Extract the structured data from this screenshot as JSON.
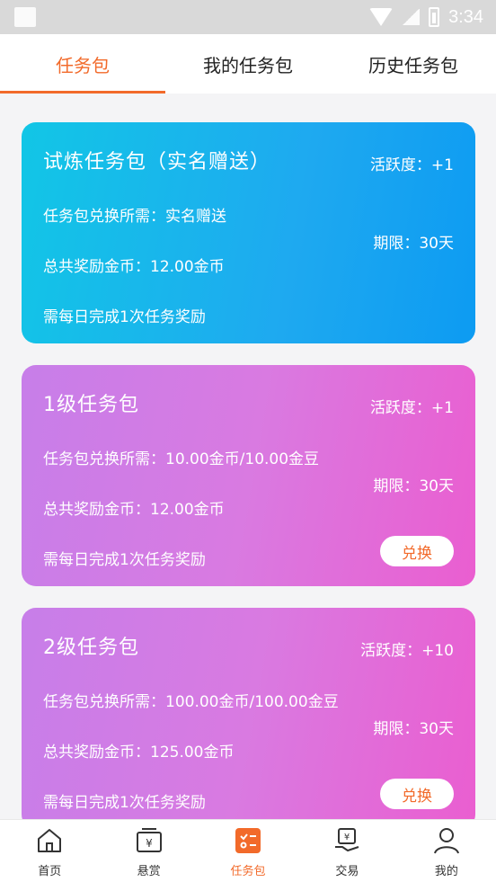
{
  "status_bar": {
    "time": "3:34"
  },
  "tabs": [
    {
      "label": "任务包",
      "active": true
    },
    {
      "label": "我的任务包",
      "active": false
    },
    {
      "label": "历史任务包",
      "active": false
    }
  ],
  "cards": [
    {
      "title": "试炼任务包（实名赠送）",
      "activity": "活跃度：+1",
      "requirement": "任务包兑换所需：实名赠送",
      "reward": "总共奖励金币：12.00金币",
      "daily": "需每日完成1次任务奖励",
      "period": "期限：30天"
    },
    {
      "title": "1级任务包",
      "activity": "活跃度：+1",
      "requirement": "任务包兑换所需：10.00金币/10.00金豆",
      "reward": "总共奖励金币：12.00金币",
      "daily": "需每日完成1次任务奖励",
      "period": "期限：30天",
      "button": "兑换"
    },
    {
      "title": "2级任务包",
      "activity": "活跃度：+10",
      "requirement": "任务包兑换所需：100.00金币/100.00金豆",
      "reward": "总共奖励金币：125.00金币",
      "daily": "需每日完成1次任务奖励",
      "period": "期限：30天",
      "button": "兑换"
    }
  ],
  "bottom_nav": [
    {
      "label": "首页",
      "icon": "home-icon"
    },
    {
      "label": "悬赏",
      "icon": "reward-icon"
    },
    {
      "label": "任务包",
      "icon": "task-pack-icon",
      "active": true
    },
    {
      "label": "交易",
      "icon": "trade-icon"
    },
    {
      "label": "我的",
      "icon": "user-icon"
    }
  ],
  "colors": {
    "accent": "#f26a2a",
    "trial_card": "#1ea9f0",
    "level_card": "#d97ae1"
  }
}
